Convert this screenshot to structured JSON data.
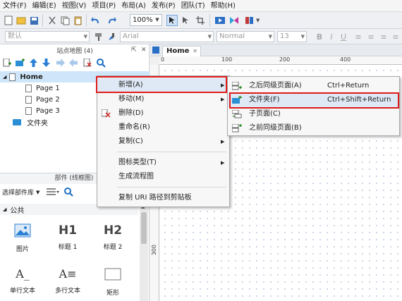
{
  "menubar": {
    "items": [
      "文件(F)",
      "编辑(E)",
      "视图(V)",
      "项目(P)",
      "布局(A)",
      "发布(P)",
      "团队(T)",
      "帮助(H)"
    ]
  },
  "toolbar": {
    "zoom": "100%",
    "font_style_placeholder": "默认",
    "font_family": "Arial",
    "font_weight": "Normal",
    "font_size": "13"
  },
  "sitemap": {
    "title": "站点地图 (4)",
    "tree": [
      {
        "label": "Home",
        "kind": "page",
        "level": 0,
        "selected": true
      },
      {
        "label": "Page 1",
        "kind": "page",
        "level": 1
      },
      {
        "label": "Page 2",
        "kind": "page",
        "level": 1
      },
      {
        "label": "Page 3",
        "kind": "page",
        "level": 1
      },
      {
        "label": "文件夹",
        "kind": "folder",
        "level": 0
      }
    ]
  },
  "widgets": {
    "title": "部件 (线框图)",
    "library_select": "选择部件库",
    "section": "公共",
    "items": [
      {
        "label": "图片",
        "glyph": "image-icon"
      },
      {
        "label": "标题 1",
        "glyph": "H1"
      },
      {
        "label": "标题 2",
        "glyph": "H2"
      },
      {
        "label": "单行文本",
        "glyph": "A_"
      },
      {
        "label": "多行文本",
        "glyph": "A≡"
      },
      {
        "label": "矩形",
        "glyph": "rect-icon"
      }
    ]
  },
  "canvas": {
    "tab_label": "Home",
    "ruler_h": [
      "0",
      "100",
      "200",
      "400"
    ],
    "ruler_v": [
      "300"
    ]
  },
  "context_menu": {
    "items": [
      {
        "label": "新增(A)",
        "has_submenu": true,
        "highlighted": true
      },
      {
        "label": "移动(M)",
        "has_submenu": true
      },
      {
        "label": "删除(D)"
      },
      {
        "label": "重命名(R)"
      },
      {
        "label": "复制(C)",
        "has_submenu": true
      },
      {
        "label": "图标类型(T)",
        "has_submenu": true
      },
      {
        "label": "生成流程图"
      },
      {
        "label": "复制 URI 路径到剪贴板"
      }
    ]
  },
  "submenu": {
    "items": [
      {
        "label": "之后同级页面(A)",
        "shortcut": "Ctrl+Return"
      },
      {
        "label": "文件夹(F)",
        "shortcut": "Ctrl+Shift+Return",
        "highlighted": true
      },
      {
        "label": "子页面(C)",
        "shortcut": ""
      },
      {
        "label": "之前同级页面(B)",
        "shortcut": ""
      }
    ]
  },
  "colors": {
    "accent_red": "#e01b1b",
    "selection_blue": "#cfe6fa",
    "folder_blue": "#2b8fd6"
  }
}
